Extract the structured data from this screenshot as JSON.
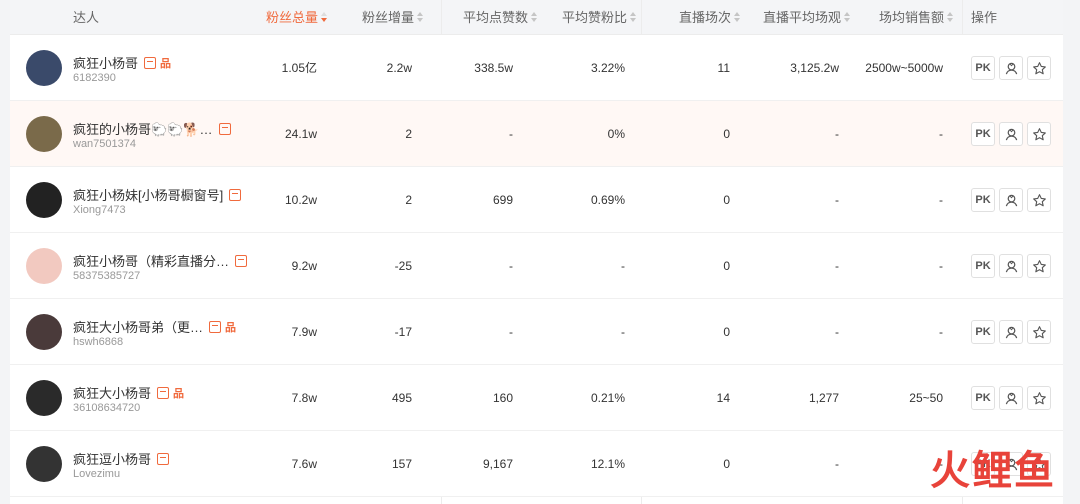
{
  "columns": {
    "talent": "达人",
    "fans_total": "粉丝总量",
    "fans_growth": "粉丝增量",
    "avg_likes": "平均点赞数",
    "avg_like_ratio": "平均赞粉比",
    "live_count": "直播场次",
    "live_avg_views": "直播平均场观",
    "avg_sales": "场均销售额",
    "actions": "操作"
  },
  "rows": [
    {
      "name": "疯狂小杨哥",
      "uid": "6182390",
      "hot": "品",
      "fans_total": "1.05亿",
      "fans_growth": "2.2w",
      "avg_likes": "338.5w",
      "avg_like_ratio": "3.22%",
      "live_count": "11",
      "live_avg_views": "3,125.2w",
      "avg_sales": "2500w~5000w",
      "avatar_color": "#3a4a6a"
    },
    {
      "name": "疯狂的小杨哥🐑🐑🐕…",
      "uid": "wan7501374",
      "hot": "",
      "fans_total": "24.1w",
      "fans_growth": "2",
      "avg_likes": "-",
      "avg_like_ratio": "0%",
      "live_count": "0",
      "live_avg_views": "-",
      "avg_sales": "-",
      "avatar_color": "#7a6a4a"
    },
    {
      "name": "疯狂小杨妹[小杨哥橱窗号]",
      "uid": "Xiong7473",
      "hot": "",
      "fans_total": "10.2w",
      "fans_growth": "2",
      "avg_likes": "699",
      "avg_like_ratio": "0.69%",
      "live_count": "0",
      "live_avg_views": "-",
      "avg_sales": "-",
      "avatar_color": "#222222"
    },
    {
      "name": "疯狂小杨哥（精彩直播分…",
      "uid": "58375385727",
      "hot": "",
      "fans_total": "9.2w",
      "fans_growth": "-25",
      "avg_likes": "-",
      "avg_like_ratio": "-",
      "live_count": "0",
      "live_avg_views": "-",
      "avg_sales": "-",
      "avatar_color": "#f2c9c0"
    },
    {
      "name": "疯狂大小杨哥弟（更…",
      "uid": "hswh6868",
      "hot": "品",
      "fans_total": "7.9w",
      "fans_growth": "-17",
      "avg_likes": "-",
      "avg_like_ratio": "-",
      "live_count": "0",
      "live_avg_views": "-",
      "avg_sales": "-",
      "avatar_color": "#4a3a3a"
    },
    {
      "name": "疯狂大小杨哥",
      "uid": "36108634720",
      "hot": "品",
      "fans_total": "7.8w",
      "fans_growth": "495",
      "avg_likes": "160",
      "avg_like_ratio": "0.21%",
      "live_count": "14",
      "live_avg_views": "1,277",
      "avg_sales": "25~50",
      "avatar_color": "#2a2a2a"
    },
    {
      "name": "疯狂逗小杨哥",
      "uid": "Lovezimu",
      "hot": "",
      "fans_total": "7.6w",
      "fans_growth": "157",
      "avg_likes": "9,167",
      "avg_like_ratio": "12.1%",
      "live_count": "0",
      "live_avg_views": "-",
      "avg_sales": "-",
      "avatar_color": "#333333"
    }
  ],
  "actions": {
    "pk_label": "PK"
  },
  "watermark": {
    "text": "火鲤鱼"
  },
  "colors": {
    "accent": "#f06a3d",
    "watermark": "#e8433a"
  }
}
